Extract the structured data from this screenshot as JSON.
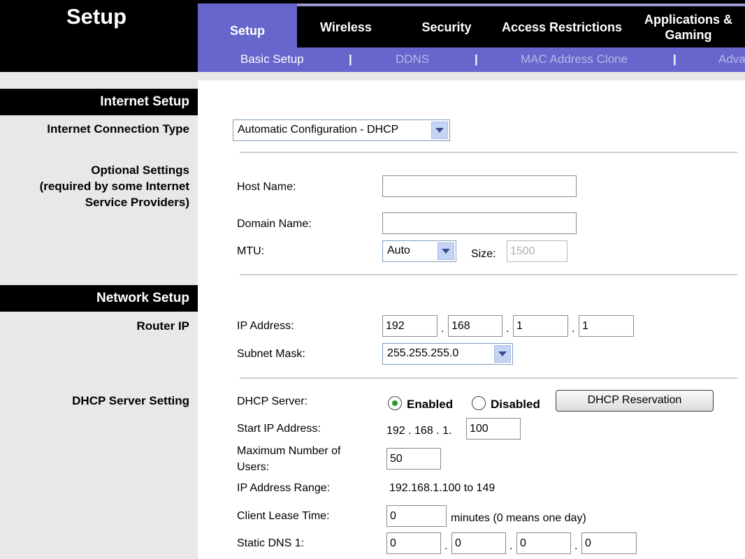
{
  "page_title": "Setup",
  "tabs": [
    {
      "label": "Setup"
    },
    {
      "label": "Wireless"
    },
    {
      "label": "Security"
    },
    {
      "label": "Access Restrictions"
    },
    {
      "label": "Applications & Gaming"
    }
  ],
  "subnav": [
    "Basic Setup",
    "DDNS",
    "MAC Address Clone",
    "Adva"
  ],
  "subnav_separator": "|",
  "sections": {
    "internet_setup": "Internet Setup",
    "network_setup": "Network Setup"
  },
  "left_labels": {
    "connection_type": "Internet Connection Type",
    "optional_settings": [
      "Optional Settings",
      "(required by some Internet",
      "Service Providers)"
    ],
    "router_ip": "Router IP",
    "dhcp_server_setting": "DHCP Server Setting"
  },
  "connection_type": {
    "selected": "Automatic Configuration - DHCP"
  },
  "optional": {
    "host_name_label": "Host Name:",
    "host_name_value": "",
    "domain_name_label": "Domain Name:",
    "domain_name_value": "",
    "mtu_label": "MTU:",
    "mtu_selected": "Auto",
    "size_label": "Size:",
    "size_value": "1500"
  },
  "router_ip": {
    "ip_label": "IP Address:",
    "ip": [
      "192",
      "168",
      "1",
      "1"
    ],
    "subnet_label": "Subnet Mask:",
    "subnet_selected": "255.255.255.0"
  },
  "dhcp": {
    "server_label": "DHCP Server:",
    "enabled_label": "Enabled",
    "disabled_label": "Disabled",
    "enabled": true,
    "reservation_button": "DHCP Reservation",
    "start_ip_label": "Start IP Address:",
    "start_ip_prefix": "192 . 168 . 1.",
    "start_ip_last": "100",
    "max_users_label": [
      "Maximum Number of",
      "Users:"
    ],
    "max_users": "50",
    "range_label": "IP Address Range:",
    "range_value": "192.168.1.100 to 149",
    "lease_label": "Client Lease Time:",
    "lease_value": "0",
    "lease_suffix": "minutes (0 means one day)",
    "dns1_label": "Static DNS 1:",
    "dns1": [
      "0",
      "0",
      "0",
      "0"
    ]
  },
  "ip_dot": "."
}
